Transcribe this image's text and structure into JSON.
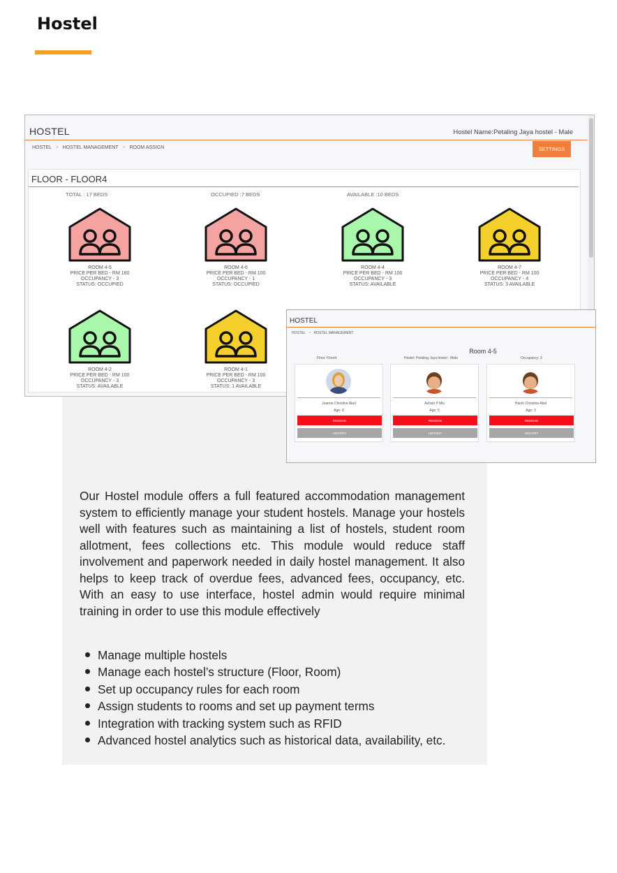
{
  "header": {
    "title": "Hostel",
    "accent": "#f4a024"
  },
  "screenshot1": {
    "title": "HOSTEL",
    "hostel_name": "Hostel Name:Petaling Jaya hostel - Male",
    "breadcrumb": [
      "HOSTEL",
      "HOSTEL MANAGEMENT",
      "ROOM ASSIGN"
    ],
    "breadcrumb_sep": ">",
    "settings_label": "SETTINGS",
    "floor_title": "FLOOR - FLOOR4",
    "stats": {
      "total": "TOTAL : 17 BEDS",
      "occupied": "OCCUPIED :7 BEDS",
      "available": "AVAILABLE :10 BEDS"
    },
    "rooms": [
      {
        "name": "ROOM 4-5",
        "price": "PRICE PER BED - RM 160",
        "occupancy": "OCCUPANCY - 3",
        "status": "STATUS: OCCUPIED",
        "color": "#f4a3a1"
      },
      {
        "name": "ROOM 4-6",
        "price": "PRICE PER BED - RM 100",
        "occupancy": "OCCUPANCY - 1",
        "status": "STATUS: OCCUPIED",
        "color": "#f4a3a1"
      },
      {
        "name": "ROOM 4-4",
        "price": "PRICE PER BED - RM 100",
        "occupancy": "OCCUPANCY - 3",
        "status": "STATUS: AVAILABLE",
        "color": "#a9f7ab"
      },
      {
        "name": "ROOM 4-7",
        "price": "PRICE PER BED - RM 100",
        "occupancy": "OCCUPANCY - 4",
        "status": "STATUS: 3 AVAILABLE",
        "color": "#f5d02c"
      },
      {
        "name": "ROOM 4-2",
        "price": "PRICE PER BED - RM 100",
        "occupancy": "OCCUPANCY - 3",
        "status": "STATUS: AVAILABLE",
        "color": "#a9f7ab"
      },
      {
        "name": "ROOM 4-1",
        "price": "PRICE PER BED - RM 100",
        "occupancy": "OCCUPANCY - 3",
        "status": "STATUS: 1 AVAILABLE",
        "color": "#f5d02c"
      }
    ]
  },
  "screenshot2": {
    "title": "HOSTEL",
    "breadcrumb": [
      "HOSTEL",
      "HOSTEL MANAGEMENT"
    ],
    "breadcrumb_sep": ">",
    "room_title": "Room 4-5",
    "floor": "Floor: Floor4",
    "hostel": "Hostel: Petaling Jaya hostel - Male",
    "occupancy": "Occupancy: 3",
    "students": [
      {
        "name": "Joanne Christine Abel",
        "age": "Age: 8"
      },
      {
        "name": "Ashish P Mis",
        "age": "Age: 5"
      },
      {
        "name": "Harsh Christine Abel",
        "age": "Age: 3"
      }
    ],
    "remove_label": "REMOVE",
    "history_label": "HISTORY"
  },
  "description": "Our Hostel module offers a full featured accommodation management system to efficiently manage your student hostels. Manage your hostels well with features such as maintaining a list of hostels, student room allotment, fees collections etc. This module would reduce staff involvement and paperwork needed in daily hostel management. It also helps to keep track of overdue fees, advanced fees, occupancy, etc. With an easy to use interface, hostel admin would require minimal training in order to use this module effectively",
  "features": [
    "Manage multiple hostels",
    "Manage each hostel’s structure (Floor, Room)",
    "Set up occupancy rules for each room",
    "Assign students to rooms and set up payment terms",
    "Integration with tracking system such as RFID",
    "Advanced hostel analytics such as historical data, availability, etc."
  ]
}
